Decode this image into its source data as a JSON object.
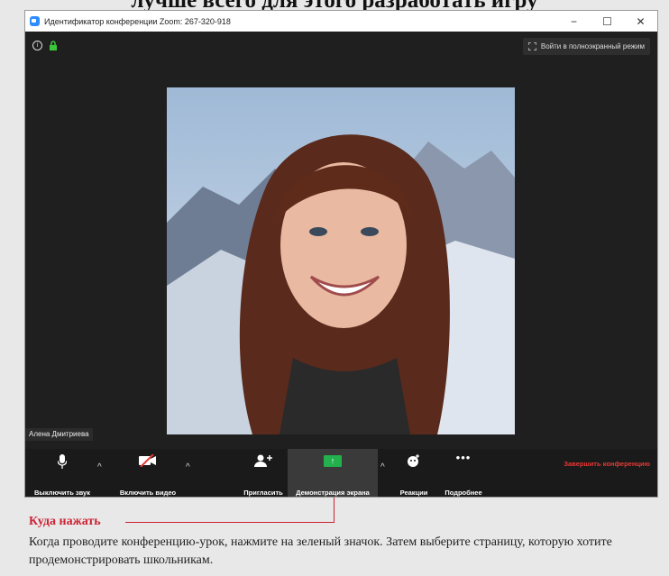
{
  "caption": "лучше всего для этого разработать игру",
  "window": {
    "title": "Идентификатор конференции Zoom: 267-320-918",
    "controls": [
      "−",
      "☐",
      "✕"
    ]
  },
  "stage": {
    "fullscreen_label": "Войти в полноэкранный режим",
    "participant_name": "Алена Дмитриева"
  },
  "toolbar": {
    "mute_label": "Выключить звук",
    "video_label": "Включить видео",
    "invite_label": "Пригласить",
    "share_label": "Демонстрация экрана",
    "reactions_label": "Реакции",
    "more_label": "Подробнее",
    "end_label": "Завершить конференцию",
    "caret": "^"
  },
  "callout": {
    "title": "Куда нажать",
    "description": "Когда проводите конференцию-урок, нажмите на зеленый значок. Затем выберите страницу, которую хотите продемонстрировать школьникам."
  },
  "colors": {
    "share_green": "#22b14c",
    "end_red": "#e53935",
    "callout_red": "#cc2233",
    "zoom_blue": "#2d8cff"
  }
}
